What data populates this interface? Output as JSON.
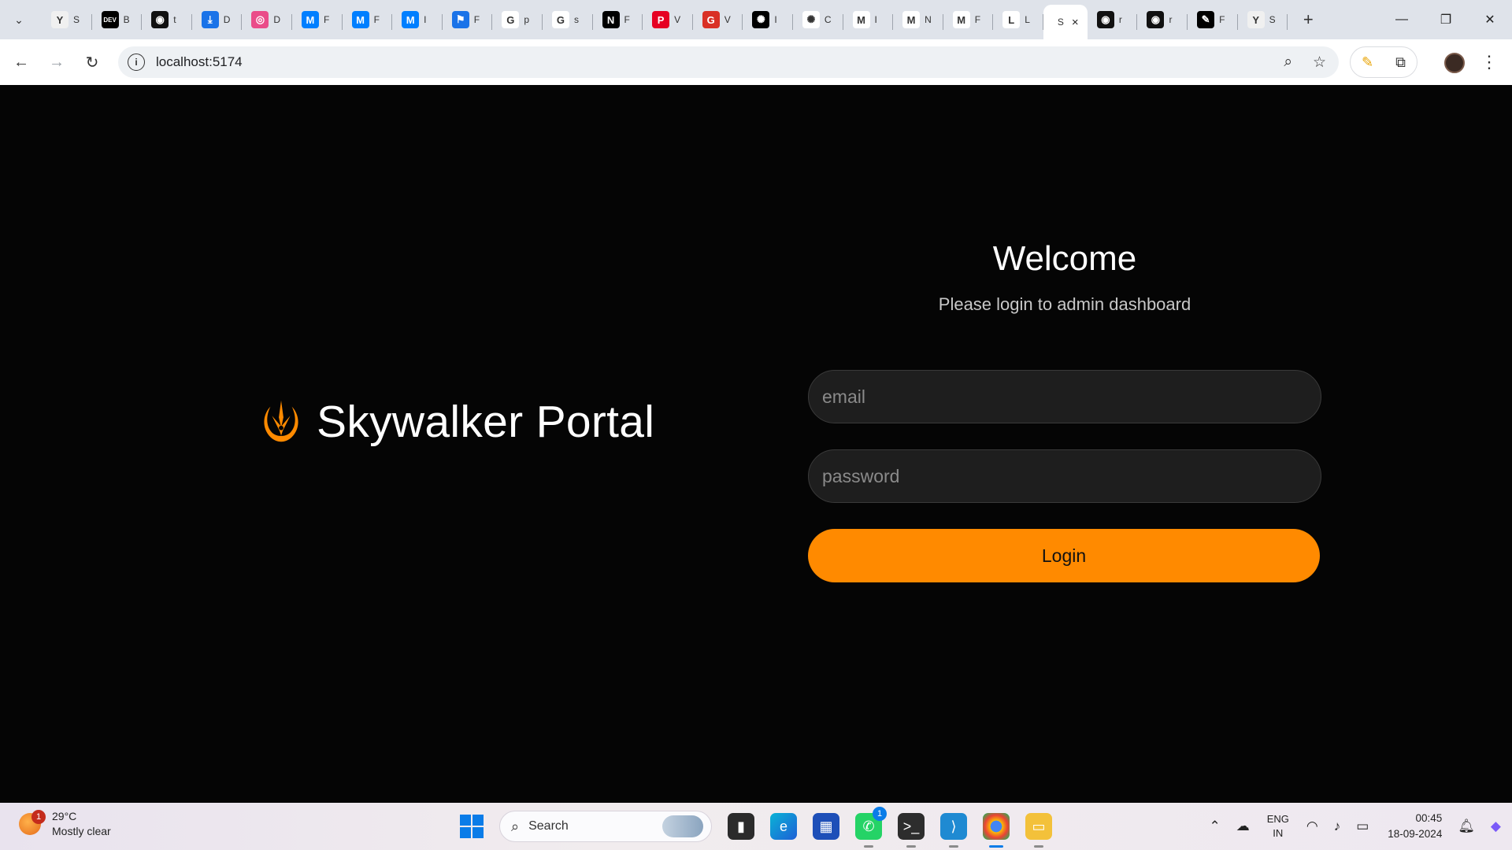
{
  "browser": {
    "tabs": [
      {
        "icon": "y-combinator-icon",
        "title": "S",
        "color": "#f0f0f0",
        "glyph": "Y"
      },
      {
        "icon": "dev-icon",
        "title": "B",
        "color": "#000000",
        "glyph": "DEV"
      },
      {
        "icon": "github-icon",
        "title": "t",
        "color": "#111111",
        "glyph": "◉"
      },
      {
        "icon": "download-icon",
        "title": "D",
        "color": "#1a73e8",
        "glyph": "⤓"
      },
      {
        "icon": "dribbble-icon",
        "title": "D",
        "color": "#ea4c89",
        "glyph": "◎"
      },
      {
        "icon": "mui-icon",
        "title": "F",
        "color": "#007fff",
        "glyph": "M"
      },
      {
        "icon": "mui-icon",
        "title": "F",
        "color": "#007fff",
        "glyph": "M"
      },
      {
        "icon": "mui-icon",
        "title": "I",
        "color": "#007fff",
        "glyph": "M"
      },
      {
        "icon": "flag-icon",
        "title": "F",
        "color": "#1a73e8",
        "glyph": "⚑"
      },
      {
        "icon": "google-icon",
        "title": "p",
        "color": "#ffffff",
        "glyph": "G"
      },
      {
        "icon": "google-icon",
        "title": "s",
        "color": "#ffffff",
        "glyph": "G"
      },
      {
        "icon": "notion-icon",
        "title": "F",
        "color": "#000000",
        "glyph": "N"
      },
      {
        "icon": "pinterest-icon",
        "title": "V",
        "color": "#e60023",
        "glyph": "P"
      },
      {
        "icon": "g-red-icon",
        "title": "V",
        "color": "#d93025",
        "glyph": "G"
      },
      {
        "icon": "openai-icon",
        "title": "I",
        "color": "#000000",
        "glyph": "✺"
      },
      {
        "icon": "openai-icon",
        "title": "C",
        "color": "#ffffff",
        "glyph": "✺"
      },
      {
        "icon": "gmail-icon",
        "title": "I",
        "color": "#ffffff",
        "glyph": "M"
      },
      {
        "icon": "gmail-icon",
        "title": "N",
        "color": "#ffffff",
        "glyph": "M"
      },
      {
        "icon": "gmail-icon",
        "title": "F",
        "color": "#ffffff",
        "glyph": "M"
      },
      {
        "icon": "l-icon",
        "title": "L",
        "color": "#ffffff",
        "glyph": "L"
      }
    ],
    "active_tab": {
      "title": "S",
      "close": "×"
    },
    "tabs_after": [
      {
        "icon": "github-icon",
        "title": "r",
        "color": "#111111",
        "glyph": "◉"
      },
      {
        "icon": "github-icon",
        "title": "r",
        "color": "#111111",
        "glyph": "◉"
      },
      {
        "icon": "puzzle-icon",
        "title": "F",
        "color": "#000000",
        "glyph": "✎"
      },
      {
        "icon": "y-combinator-icon",
        "title": "S",
        "color": "#f0f0f0",
        "glyph": "Y"
      }
    ],
    "url": "localhost:5174"
  },
  "page": {
    "brand_name": "Skywalker Portal",
    "brand_color": "#ff8a00",
    "welcome": "Welcome",
    "subtitle": "Please login to admin dashboard",
    "email_placeholder": "email",
    "password_placeholder": "password",
    "login_label": "Login"
  },
  "taskbar": {
    "weather_temp": "29°C",
    "weather_desc": "Mostly clear",
    "weather_badge": "1",
    "search_label": "Search",
    "whatsapp_badge": "1",
    "lang_1": "ENG",
    "lang_2": "IN",
    "time": "00:45",
    "date": "18-09-2024"
  }
}
